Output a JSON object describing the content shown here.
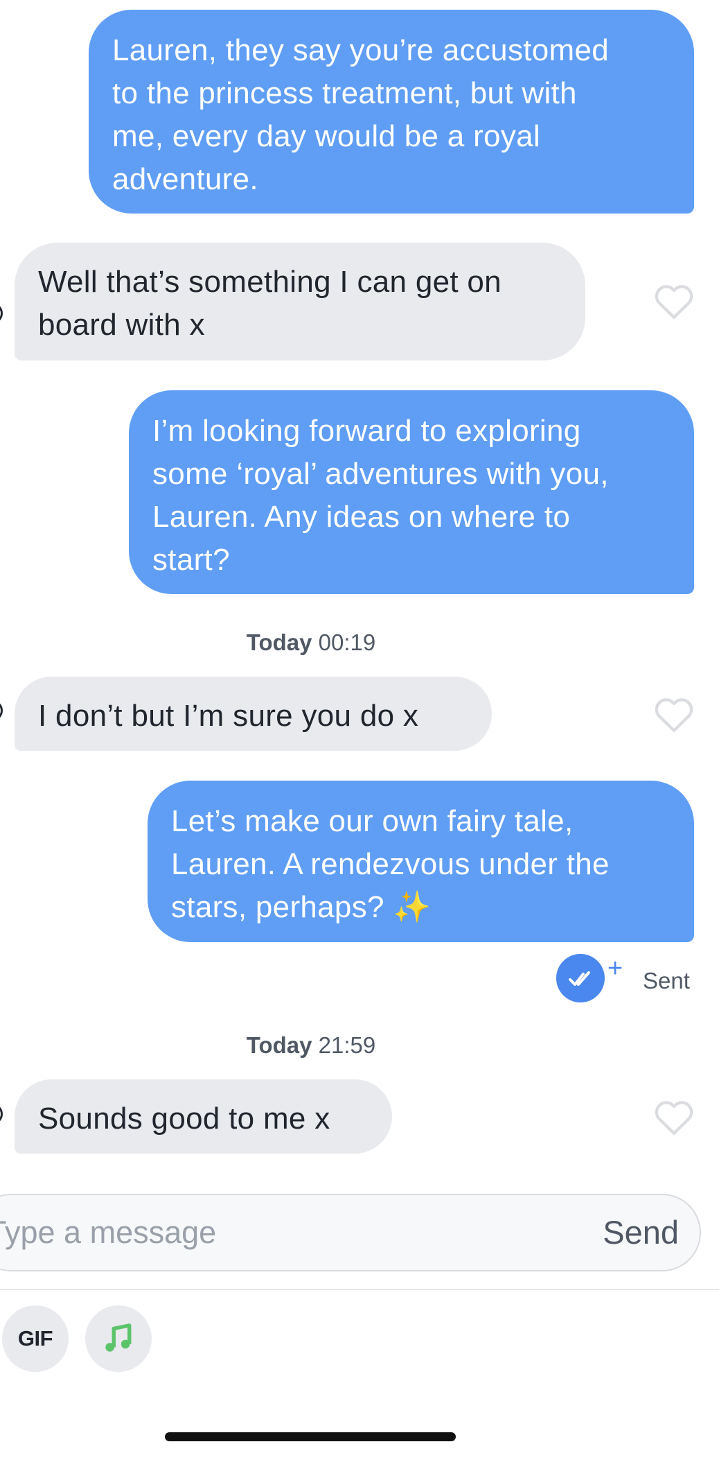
{
  "messages": [
    {
      "direction": "outgoing",
      "text": "Lauren, they say you’re accustomed\nto the princess treatment, but with\nme, every day would be a royal\nadventure."
    },
    {
      "direction": "incoming",
      "text": "Well that’s something I can get on\nboard with x"
    },
    {
      "direction": "outgoing",
      "text": "I’m looking forward to exploring\nsome ‘royal’ adventures with you,\nLauren. Any ideas on where to\nstart?"
    },
    {
      "direction": "incoming",
      "text": "I don’t but I’m sure you do x"
    },
    {
      "direction": "outgoing",
      "text": "Let’s make our own fairy tale,\nLauren. A rendezvous under the\nstars, perhaps? ✨"
    },
    {
      "direction": "incoming",
      "text": "Sounds good to me x"
    }
  ],
  "timestamps": [
    {
      "day": "Today",
      "time": "00:19"
    },
    {
      "day": "Today",
      "time": "21:59"
    }
  ],
  "receipt": {
    "status": "Sent",
    "icon": "double-check-icon",
    "plus": "+"
  },
  "icons": {
    "like": "heart-outline-icon",
    "music": "music-note-icon"
  },
  "composer": {
    "placeholder": "Type a message",
    "send_label": "Send"
  },
  "tools": {
    "gif_label": "GIF"
  },
  "colors": {
    "outgoing_bubble": "#5f9ef4",
    "incoming_bubble": "#e9eaee",
    "receipt": "#4a87ee",
    "music_icon": "#5bc46a",
    "heart_outline": "#dadce0"
  }
}
